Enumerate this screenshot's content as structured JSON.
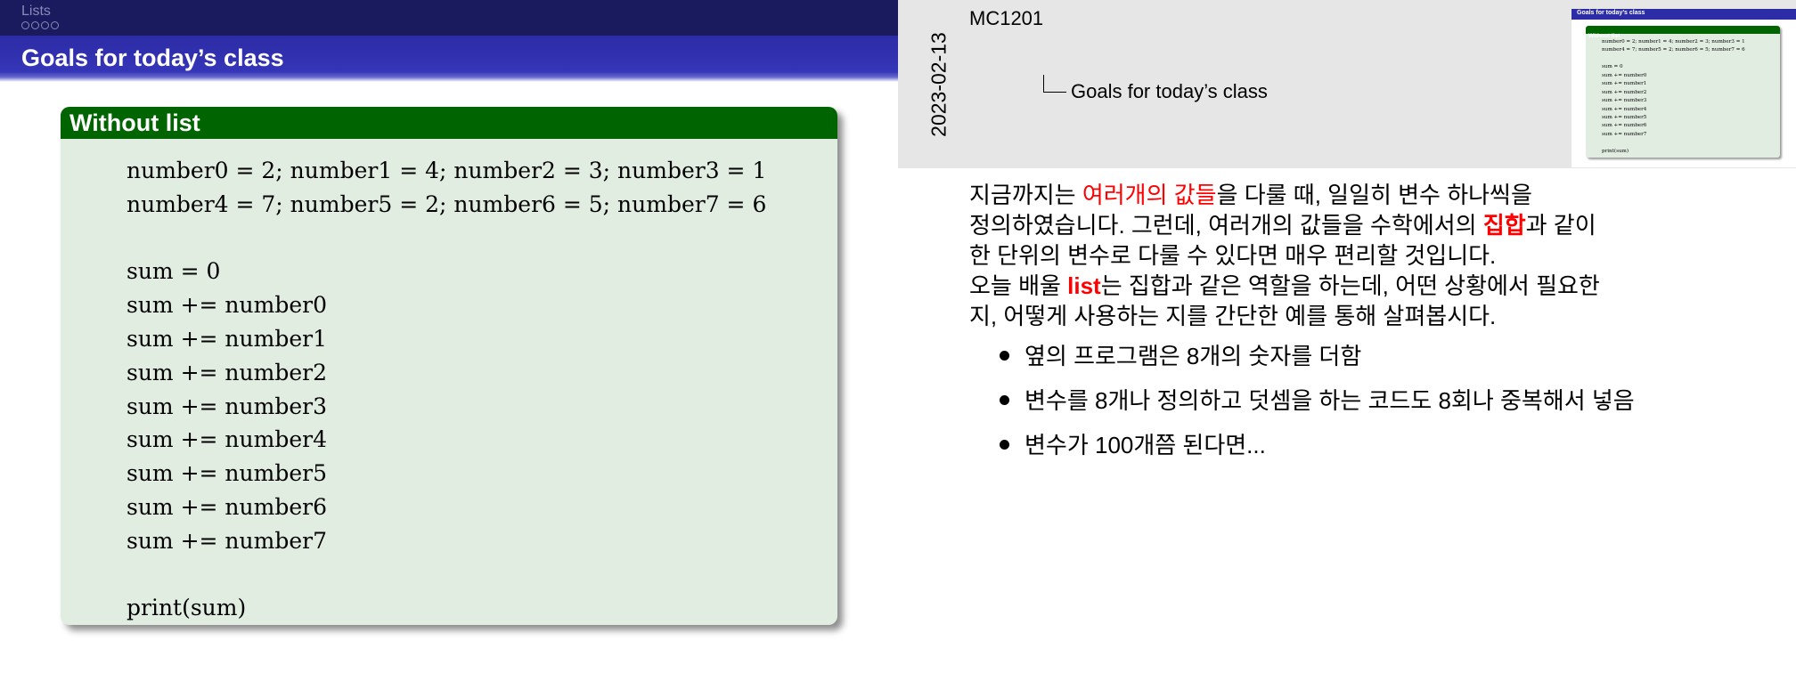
{
  "slide": {
    "section": "Lists",
    "nav_dots": 4,
    "frame_title": "Goals for today’s class",
    "block_title": "Without list",
    "code_lines": [
      "number0 = 2; number1 = 4; number2 = 3; number3 = 1",
      "number4 = 7; number5 = 2; number6 = 5; number7 = 6",
      "",
      "sum = 0",
      "sum += number0",
      "sum += number1",
      "sum += number2",
      "sum += number3",
      "sum += number4",
      "sum += number5",
      "sum += number6",
      "sum += number7",
      "",
      "print(sum)"
    ]
  },
  "notes": {
    "date": "2023-02-13",
    "course": "MC1201",
    "tree_title": "Goals for today’s class",
    "thumbnail": {
      "frame_title": "Goals for today’s class",
      "block_title": "Without list",
      "code_lines": [
        "number0 = 2; number1 = 4; number2 = 3; number3 = 1",
        "number4 = 7; number5 = 2; number6 = 5; number7 = 6",
        "",
        "sum = 0",
        "sum += number0",
        "sum += number1",
        "sum += number2",
        "sum += number3",
        "sum += number4",
        "sum += number5",
        "sum += number6",
        "sum += number7",
        "",
        "print(sum)"
      ]
    },
    "paragraph": {
      "l1_a": "지금까지는 ",
      "l1_hl": "여러개의 값들",
      "l1_b": "을 다룰 때, 일일히 변수 하나씩을",
      "l2_a": "정의하였습니다. 그런데, 여러개의 값들을 수학에서의 ",
      "l2_hl": "집합",
      "l2_b": "과 같이",
      "l3": "한 단위의 변수로 다룰 수 있다면 매우 편리할 것입니다.",
      "l4_a": "오늘 배울 ",
      "l4_hl": "list",
      "l4_b": "는 집합과 같은 역할을 하는데, 어떤 상황에서 필요한",
      "l5": "지, 어떻게 사용하는 지를 간단한 예를 통해 살펴봅시다."
    },
    "bullets": [
      "옆의 프로그램은 8개의 숫자를 더함",
      "변수를 8개나 정의하고 덧셈을 하는 코드도 8회나 중복해서 넣음",
      "변수가 100개쯤 된다면..."
    ]
  },
  "colors": {
    "header_dark": "#1a1a5e",
    "frame_title_bar": "#3535b8",
    "block_title_bar": "#006400",
    "block_body": "#e2ede2",
    "highlight": "#ff0000",
    "notes_header": "#e6e6e6"
  }
}
